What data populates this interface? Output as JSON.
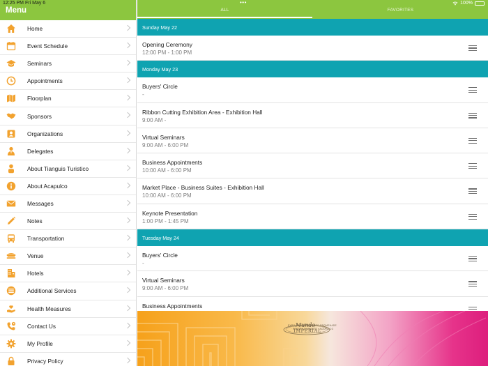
{
  "status_bar": {
    "time": "12:25 PM",
    "date": "Fri May 6",
    "battery": "100%"
  },
  "sidebar": {
    "title": "Menu",
    "items": [
      {
        "label": "Home",
        "icon": "home-icon",
        "color": "#f2a22e"
      },
      {
        "label": "Event Schedule",
        "icon": "calendar-icon",
        "color": "#f2a22e"
      },
      {
        "label": "Seminars",
        "icon": "graduation-cap-icon",
        "color": "#f2a22e"
      },
      {
        "label": "Appointments",
        "icon": "clock-icon",
        "color": "#f2a22e"
      },
      {
        "label": "Floorplan",
        "icon": "map-icon",
        "color": "#f2a22e"
      },
      {
        "label": "Sponsors",
        "icon": "handshake-icon",
        "color": "#f2a22e"
      },
      {
        "label": "Organizations",
        "icon": "contact-card-icon",
        "color": "#f2a22e"
      },
      {
        "label": "Delegates",
        "icon": "person-tie-icon",
        "color": "#f2a22e"
      },
      {
        "label": "About Tianguis Turistico",
        "icon": "person-icon",
        "color": "#f2a22e"
      },
      {
        "label": "About Acapulco",
        "icon": "info-icon",
        "color": "#f2a22e"
      },
      {
        "label": "Messages",
        "icon": "envelope-icon",
        "color": "#f2a22e"
      },
      {
        "label": "Notes",
        "icon": "pencil-icon",
        "color": "#f2a22e"
      },
      {
        "label": "Transportation",
        "icon": "bus-icon",
        "color": "#f2a22e"
      },
      {
        "label": "Venue",
        "icon": "venue-icon",
        "color": "#f2a22e"
      },
      {
        "label": "Hotels",
        "icon": "building-icon",
        "color": "#f2a22e"
      },
      {
        "label": "Additional Services",
        "icon": "services-icon",
        "color": "#f2a22e"
      },
      {
        "label": "Health Measures",
        "icon": "health-hand-icon",
        "color": "#f2a22e"
      },
      {
        "label": "Contact Us",
        "icon": "phone-icon",
        "color": "#f2a22e"
      },
      {
        "label": "My Profile",
        "icon": "gear-icon",
        "color": "#f2a22e"
      },
      {
        "label": "Privacy Policy",
        "icon": "lock-icon",
        "color": "#f2a22e"
      }
    ]
  },
  "tabs": {
    "all": "ALL",
    "favorites": "FAVORITES",
    "active": "all"
  },
  "schedule": [
    {
      "day": "Sunday May 22",
      "events": [
        {
          "title": "Opening Ceremony",
          "time": "12:00 PM - 1:00 PM"
        }
      ]
    },
    {
      "day": "Monday May 23",
      "events": [
        {
          "title": "Buyers' Circle",
          "time": "-"
        },
        {
          "title": "Ribbon Cutting Exhibition Area - Exhibition Hall",
          "time": "9:00 AM -"
        },
        {
          "title": "Virtual Seminars",
          "time": "9:00 AM - 6:00 PM"
        },
        {
          "title": "Business Appointments",
          "time": "10:00 AM - 6:00 PM"
        },
        {
          "title": "Market Place - Business Suites - Exhibition Hall",
          "time": "10:00 AM - 6:00 PM"
        },
        {
          "title": "Keynote Presentation",
          "time": "1:00 PM - 1:45 PM"
        }
      ]
    },
    {
      "day": "Tuesday May 24",
      "events": [
        {
          "title": "Buyers' Circle",
          "time": "-"
        },
        {
          "title": "Virtual Seminars",
          "time": "9:00 AM - 6:00 PM"
        },
        {
          "title": "Business Appointments",
          "time": "10:00 AM - 6:00 PM"
        }
      ]
    }
  ],
  "banner": {
    "logo_line1": "Mundo",
    "logo_line2": "IMPERIAL",
    "logo_line3": "EXPO·FORUM·RESORTS·PROMENADE",
    "logo_line4": "· RIVIERA DIAMANTE · ACAPULCO"
  },
  "colors": {
    "brand_green": "#8cc63f",
    "day_header_teal": "#0fa3b1",
    "icon_orange": "#f2a22e"
  }
}
